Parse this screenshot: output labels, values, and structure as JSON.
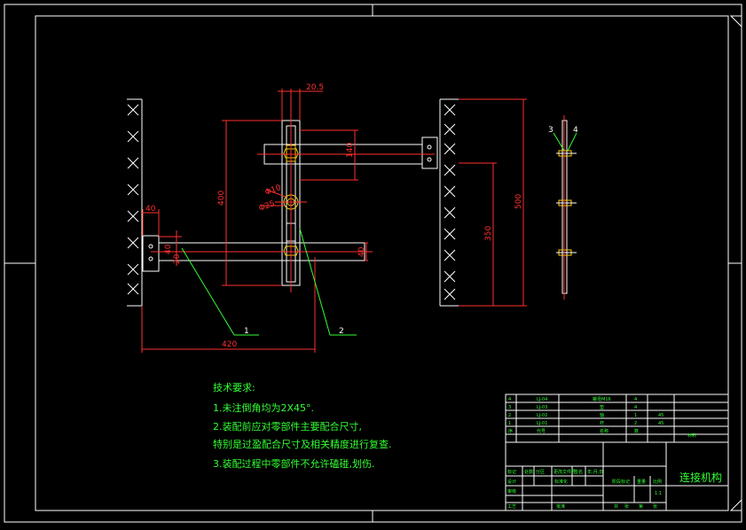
{
  "drawing": {
    "title": "连接机构",
    "dimensions": {
      "top_width": "20.5",
      "vertical_140": "140",
      "height_400": "400",
      "dia_10": "Φ10",
      "dia_25": "Φ25",
      "width_40": "40",
      "small_40": "40",
      "small_20": "20",
      "right_40": "40",
      "total_420": "420",
      "height_500": "500",
      "height_350": "350"
    },
    "leaders": {
      "part1": "1",
      "part2": "2",
      "part3": "3",
      "part4": "4"
    },
    "tech_requirements": {
      "heading": "技术要求:",
      "line1": "1.未注倒角均为2X45°.",
      "line2": "2.装配前应对零部件主要配合尺寸,",
      "line3": "特别是过盈配合尺寸及相关精度进行复查.",
      "line4": "3.装配过程中零部件不允许磕碰,划伤."
    },
    "bom_rows": [
      {
        "no": "4",
        "code": "LJ-04",
        "name": "螺母M16",
        "qty": "4",
        "mat": ""
      },
      {
        "no": "3",
        "code": "LJ-03",
        "name": "垫",
        "qty": "4",
        "mat": ""
      },
      {
        "no": "2",
        "code": "LJ-02",
        "name": "轴",
        "qty": "1",
        "mat": "45"
      },
      {
        "no": "1",
        "code": "LJ-01",
        "name": "杆",
        "qty": "2",
        "mat": "45"
      },
      {
        "no": "序",
        "code": "代号",
        "name": "名称",
        "qty": "数",
        "mat": "材料"
      }
    ],
    "title_block": {
      "col_headers": [
        "标记",
        "处数",
        "分区",
        "更改文件号",
        "签名",
        "年,月,日"
      ],
      "design": "设计",
      "standard": "标准化",
      "check": "审核",
      "process": "工艺",
      "approve": "批准",
      "stage_mark": "阶段标记",
      "weight": "重量",
      "scale": "比例",
      "scale_val": "1:1",
      "sheet_total": "共",
      "sheet_no": "张",
      "sheet_of": "第",
      "sheet_page": "张"
    }
  }
}
